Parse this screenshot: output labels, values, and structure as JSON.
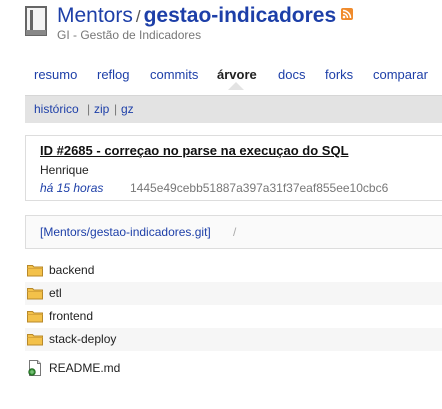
{
  "header": {
    "owner": "Mentors",
    "separator": "/",
    "repo": "gestao-indicadores",
    "description": "GI - Gestão de Indicadores",
    "repo_icon": "repository-icon",
    "feed_icon": "rss-icon"
  },
  "nav": {
    "tabs": [
      {
        "label": "resumo",
        "active": false
      },
      {
        "label": "reflog",
        "active": false
      },
      {
        "label": "commits",
        "active": false
      },
      {
        "label": "árvore",
        "active": true
      },
      {
        "label": "docs",
        "active": false
      },
      {
        "label": "forks",
        "active": false
      },
      {
        "label": "comparar",
        "active": false
      }
    ]
  },
  "subnav": {
    "history": "histórico",
    "zip": "zip",
    "gz": "gz",
    "sep": "|"
  },
  "commit": {
    "message": "ID #2685 - correçao no parse na execuçao do SQL",
    "author": "Henrique",
    "age": "há 15 horas",
    "hash": "1445e49cebb51887a397a31f37eaf855ee10cbc6"
  },
  "path": {
    "root": "[Mentors/gestao-indicadores.git]",
    "sep": "/"
  },
  "tree": {
    "folders": [
      {
        "name": "backend",
        "icon": "folder-icon"
      },
      {
        "name": "etl",
        "icon": "folder-icon"
      },
      {
        "name": "frontend",
        "icon": "folder-icon"
      },
      {
        "name": "stack-deploy",
        "icon": "folder-icon"
      }
    ],
    "files": [
      {
        "name": "README.md",
        "icon": "document-icon"
      }
    ]
  },
  "colors": {
    "link": "#1d3fa8",
    "folder": "#f3c14a",
    "subnav_bg": "#e3e3e3",
    "rss": "#f08b2c"
  }
}
